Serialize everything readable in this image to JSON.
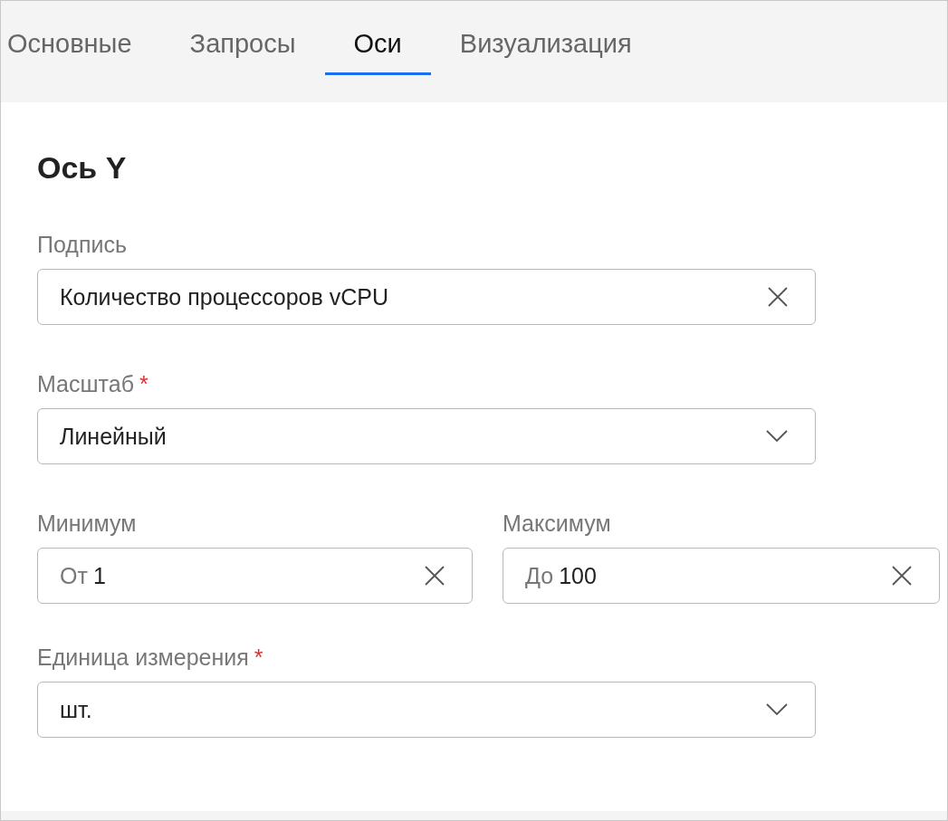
{
  "tabs": [
    {
      "label": "Основные",
      "selected": false
    },
    {
      "label": "Запросы",
      "selected": false
    },
    {
      "label": "Оси",
      "selected": true
    },
    {
      "label": "Визуализация",
      "selected": false
    }
  ],
  "section_title": "Ось Y",
  "fields": [
    {
      "kind": "text",
      "label": "Подпись",
      "value": "Количество процессоров vCPU"
    },
    {
      "kind": "select",
      "label": "Масштаб",
      "required_mark": "*",
      "value": "Линейный"
    },
    {
      "kind": "range",
      "items": [
        {
          "label": "Минимум",
          "prefix": "От",
          "value": "1"
        },
        {
          "label": "Максимум",
          "prefix": "До",
          "value": "100"
        }
      ]
    },
    {
      "kind": "select",
      "label": "Единица измерения",
      "required_mark": "*",
      "value": "шт."
    }
  ]
}
